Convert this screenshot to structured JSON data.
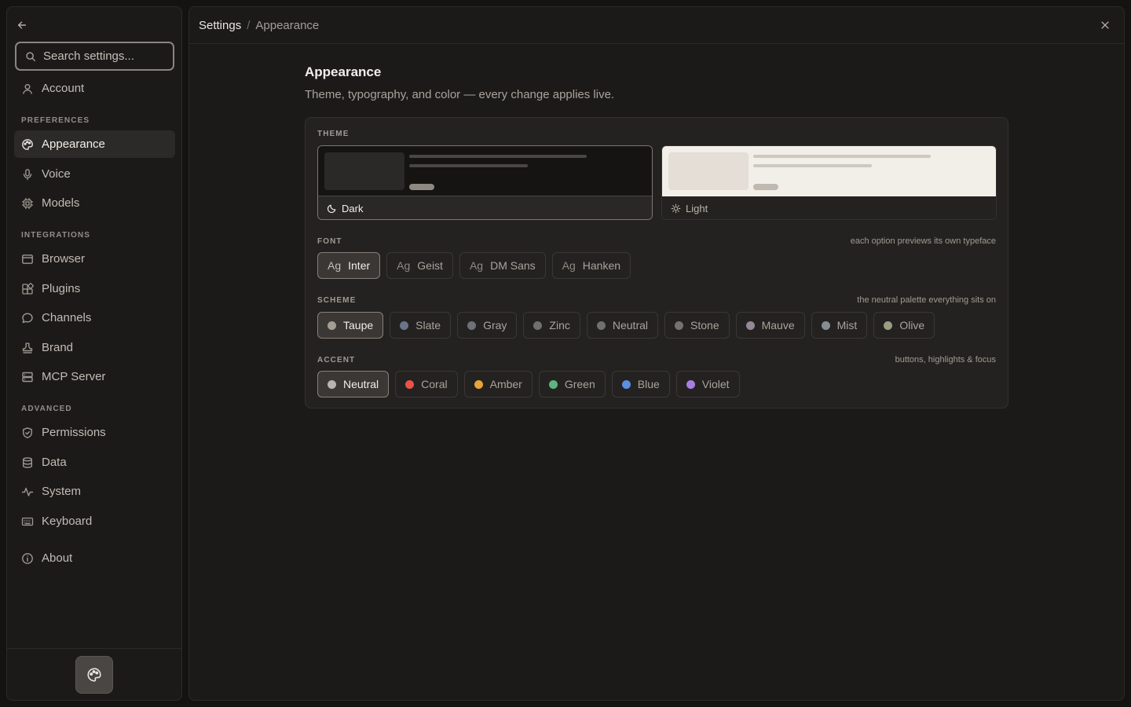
{
  "sidebar": {
    "search_placeholder": "Search settings...",
    "account_label": "Account",
    "sections": {
      "preferences": "PREFERENCES",
      "integrations": "INTEGRATIONS",
      "advanced": "ADVANCED"
    },
    "items": {
      "appearance": "Appearance",
      "voice": "Voice",
      "models": "Models",
      "browser": "Browser",
      "plugins": "Plugins",
      "channels": "Channels",
      "brand": "Brand",
      "mcp_server": "MCP Server",
      "permissions": "Permissions",
      "data": "Data",
      "system": "System",
      "keyboard": "Keyboard",
      "about": "About"
    },
    "active_item": "Appearance"
  },
  "header": {
    "breadcrumb_root": "Settings",
    "breadcrumb_separator": "/",
    "breadcrumb_current": "Appearance"
  },
  "page": {
    "title": "Appearance",
    "subtitle": "Theme, typography, and color — every change applies live."
  },
  "theme": {
    "label": "THEME",
    "options": [
      {
        "label": "Dark",
        "selected": true,
        "icon": "moon-icon"
      },
      {
        "label": "Light",
        "selected": false,
        "icon": "sun-icon"
      }
    ]
  },
  "font": {
    "label": "FONT",
    "hint": "each option previews its own typeface",
    "sample": "Ag",
    "options": [
      {
        "label": "Inter",
        "selected": true
      },
      {
        "label": "Geist",
        "selected": false
      },
      {
        "label": "DM Sans",
        "selected": false
      },
      {
        "label": "Hanken",
        "selected": false
      }
    ]
  },
  "scheme": {
    "label": "SCHEME",
    "hint": "the neutral palette everything sits on",
    "options": [
      {
        "label": "Taupe",
        "color": "#a59d94",
        "selected": true
      },
      {
        "label": "Slate",
        "color": "#6b7489",
        "selected": false
      },
      {
        "label": "Gray",
        "color": "#6e717a",
        "selected": false
      },
      {
        "label": "Zinc",
        "color": "#6f6f74",
        "selected": false
      },
      {
        "label": "Neutral",
        "color": "#707070",
        "selected": false
      },
      {
        "label": "Stone",
        "color": "#76716c",
        "selected": false
      },
      {
        "label": "Mauve",
        "color": "#958896",
        "selected": false
      },
      {
        "label": "Mist",
        "color": "#858d93",
        "selected": false
      },
      {
        "label": "Olive",
        "color": "#9a9c84",
        "selected": false
      }
    ]
  },
  "accent": {
    "label": "ACCENT",
    "hint": "buttons, highlights & focus",
    "options": [
      {
        "label": "Neutral",
        "color": "#b9b4ae",
        "selected": true
      },
      {
        "label": "Coral",
        "color": "#e5534b",
        "selected": false
      },
      {
        "label": "Amber",
        "color": "#e7a43a",
        "selected": false
      },
      {
        "label": "Green",
        "color": "#5cb57e",
        "selected": false
      },
      {
        "label": "Blue",
        "color": "#5b8fe3",
        "selected": false
      },
      {
        "label": "Violet",
        "color": "#a77ee0",
        "selected": false
      }
    ]
  },
  "colors": {
    "background": "#141312",
    "panel": "#1c1a19",
    "card": "#242220",
    "text": "#e8e4df",
    "muted": "#a9a39c"
  }
}
